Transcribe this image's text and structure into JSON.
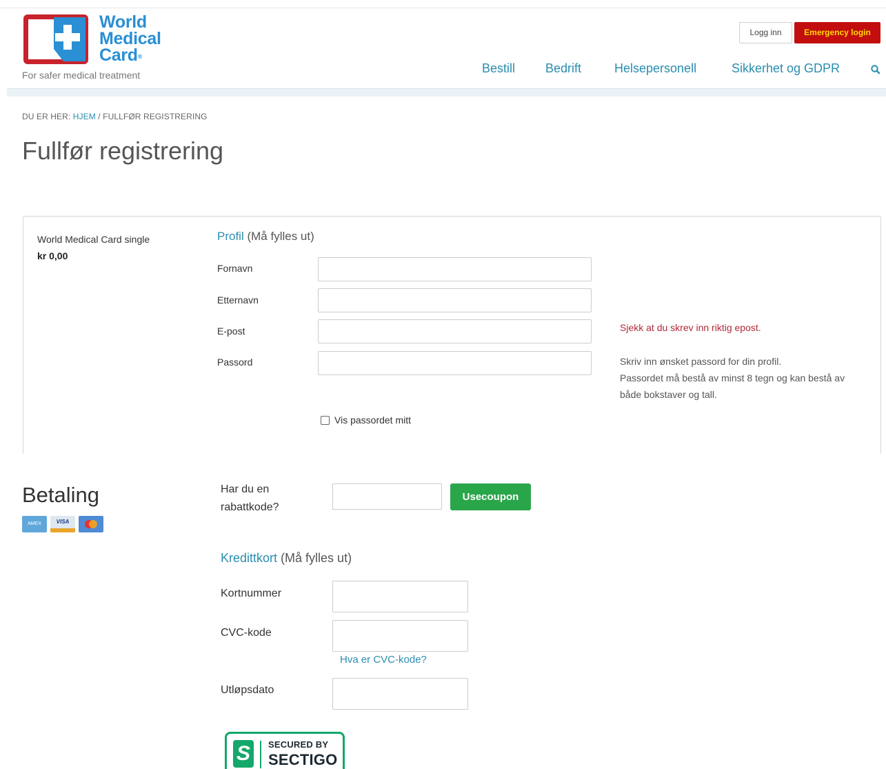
{
  "header": {
    "logo_lines": [
      "World",
      "Medical",
      "Card"
    ],
    "logo_mark": "®",
    "tagline": "For safer medical treatment",
    "login_label": "Logg inn",
    "emergency_label": "Emergency login",
    "nav": [
      "Bestill",
      "Bedrift",
      "Helsepersonell",
      "Sikkerhet og GDPR"
    ],
    "search_icon": "search-icon"
  },
  "breadcrumb": {
    "prefix": "DU ER HER:",
    "home": "HJEM",
    "separator": "/",
    "current": "FULLFØR REGISTRERING"
  },
  "page_title": "Fullfør registrering",
  "product": {
    "name": "World Medical Card single",
    "price": "kr 0,00"
  },
  "profile": {
    "title": "Profil",
    "required": "(Må fylles ut)",
    "fields": [
      {
        "label": "Fornavn",
        "value": ""
      },
      {
        "label": "Etternavn",
        "value": ""
      },
      {
        "label": "E-post",
        "value": ""
      },
      {
        "label": "Passord",
        "value": ""
      }
    ],
    "email_error": "Sjekk at du skrev inn riktig epost.",
    "password_help_1": "Skriv inn ønsket passord for din profil.",
    "password_help_2": "Passordet må bestå av minst 8 tegn og kan bestå av både bokstaver og tall.",
    "show_password_label": "Vis passordet mitt",
    "show_password_checked": false
  },
  "payment": {
    "title": "Betaling",
    "card_logos": [
      "AMEX",
      "VISA",
      "mastercard"
    ],
    "coupon_label": "Har du en rabattkode?",
    "coupon_value": "",
    "coupon_button": "Usecoupon",
    "credit_title": "Kredittkort",
    "credit_required": "(Må fylles ut)",
    "card_fields": [
      {
        "label": "Kortnummer",
        "value": ""
      },
      {
        "label": "CVC-kode",
        "value": ""
      },
      {
        "label": "Utløpsdato",
        "value": ""
      }
    ],
    "cvc_help_link": "Hva er CVC-kode?"
  },
  "badge": {
    "letter": "S",
    "line1": "SECURED BY",
    "line2": "SECTIGO"
  },
  "colors": {
    "accent": "#2a8db0",
    "logo_blue": "#2a8fd4",
    "emergency": "#c20e0e",
    "emergency_text": "#ffd800",
    "error": "#b02a37",
    "coupon_button": "#2aa64a",
    "sectigo": "#14a86b"
  }
}
